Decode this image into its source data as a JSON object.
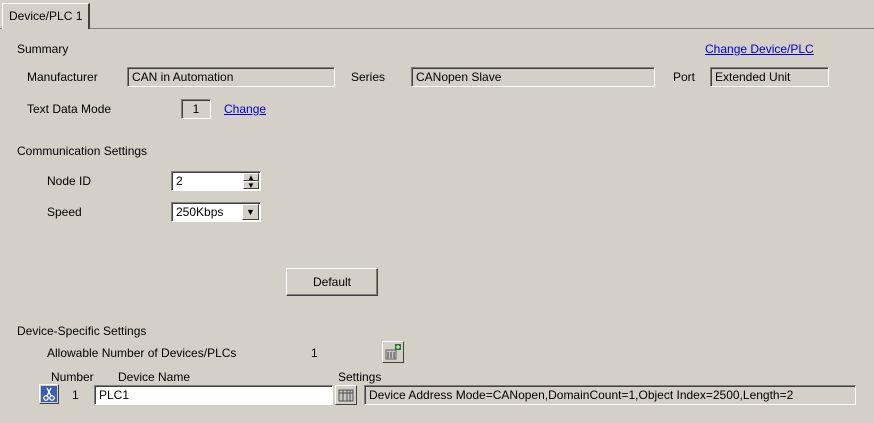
{
  "tab": {
    "label": "Device/PLC 1"
  },
  "summary": {
    "heading": "Summary",
    "change_device_link": "Change Device/PLC",
    "manufacturer_label": "Manufacturer",
    "manufacturer_value": "CAN in Automation",
    "series_label": "Series",
    "series_value": "CANopen Slave",
    "port_label": "Port",
    "port_value": "Extended Unit",
    "text_data_mode_label": "Text Data Mode",
    "text_data_mode_value": "1",
    "change_link": "Change"
  },
  "communication": {
    "heading": "Communication Settings",
    "node_id_label": "Node ID",
    "node_id_value": "2",
    "speed_label": "Speed",
    "speed_value": "250Kbps",
    "default_button": "Default"
  },
  "device_specific": {
    "heading": "Device-Specific Settings",
    "allowable_label": "Allowable Number of Devices/PLCs",
    "allowable_value": "1",
    "col_number": "Number",
    "col_device_name": "Device Name",
    "col_settings": "Settings",
    "rows": [
      {
        "number": "1",
        "device_name": "PLC1",
        "settings": "Device Address Mode=CANopen,DomainCount=1,Object Index=2500,Length=2"
      }
    ]
  },
  "icons": {
    "add_device": "add-device-icon",
    "row_edit": "scissors-icon",
    "settings": "settings-table-icon"
  }
}
